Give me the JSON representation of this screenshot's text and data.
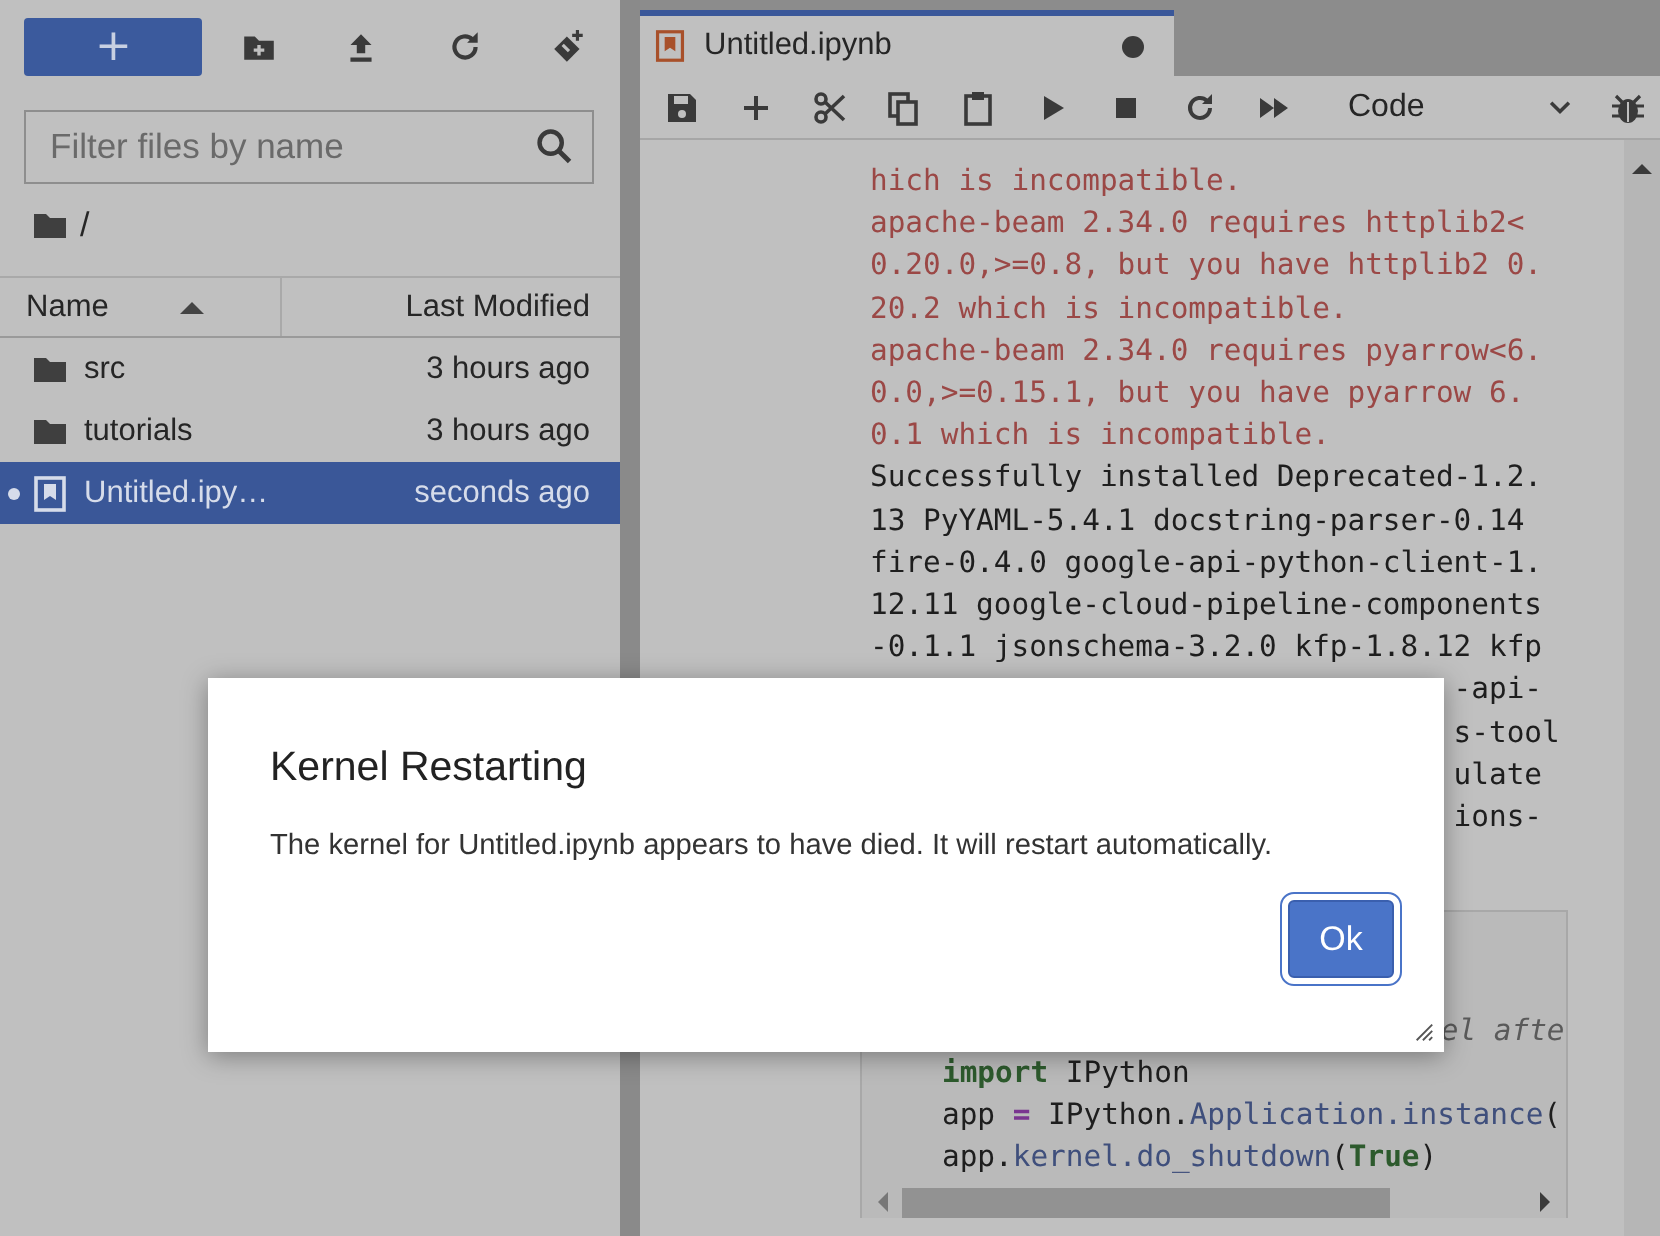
{
  "sidebar": {
    "new_button": "+",
    "filter": {
      "placeholder": "Filter files by name"
    },
    "breadcrumb": "/",
    "columns": [
      {
        "label": "Name",
        "sorted": true
      },
      {
        "label": "Last Modified",
        "sorted": false
      }
    ],
    "files": [
      {
        "kind": "folder",
        "name": "src",
        "modified": "3 hours ago",
        "selected": false,
        "running": false
      },
      {
        "kind": "folder",
        "name": "tutorials",
        "modified": "3 hours ago",
        "selected": false,
        "running": false
      },
      {
        "kind": "notebook",
        "name": "Untitled.ipy…",
        "modified": "seconds ago",
        "selected": true,
        "running": true
      }
    ]
  },
  "notebook": {
    "tab": {
      "title": "Untitled.ipynb",
      "dirty": true
    },
    "cell_type": "Code",
    "output": [
      {
        "kind": "stderr",
        "text": "hich is incompatible."
      },
      {
        "kind": "stderr",
        "text": "apache-beam 2.34.0 requires httplib2<"
      },
      {
        "kind": "stderr",
        "text": "0.20.0,>=0.8, but you have httplib2 0."
      },
      {
        "kind": "stderr",
        "text": "20.2 which is incompatible."
      },
      {
        "kind": "stderr",
        "text": "apache-beam 2.34.0 requires pyarrow<6."
      },
      {
        "kind": "stderr",
        "text": "0.0,>=0.15.1, but you have pyarrow 6."
      },
      {
        "kind": "stderr",
        "text": "0.1 which is incompatible."
      },
      {
        "kind": "stdout",
        "text": "Successfully installed Deprecated-1.2."
      },
      {
        "kind": "stdout",
        "text": "13 PyYAML-5.4.1 docstring-parser-0.14"
      },
      {
        "kind": "stdout",
        "text": "fire-0.4.0 google-api-python-client-1."
      },
      {
        "kind": "stdout",
        "text": "12.11 google-cloud-pipeline-components"
      },
      {
        "kind": "stdout",
        "text": "-0.1.1 jsonschema-3.2.0 kfp-1.8.12 kfp"
      },
      {
        "kind": "covered",
        "text": "-api-"
      },
      {
        "kind": "covered",
        "text": "s-tool"
      },
      {
        "kind": "covered",
        "text": "ulate"
      },
      {
        "kind": "covered",
        "text": "ions-"
      }
    ],
    "code": [
      [
        {
          "kind": "covered-comment",
          "text": "el afte"
        }
      ],
      [
        {
          "kind": "keyword",
          "text": "import"
        },
        {
          "kind": "plain",
          "text": " IPython"
        }
      ],
      [
        {
          "kind": "plain",
          "text": "app "
        },
        {
          "kind": "operator",
          "text": "="
        },
        {
          "kind": "plain",
          "text": " IPython."
        },
        {
          "kind": "attr",
          "text": "Application.instance"
        },
        {
          "kind": "plain",
          "text": "("
        }
      ],
      [
        {
          "kind": "plain",
          "text": "app."
        },
        {
          "kind": "attr",
          "text": "kernel.do_shutdown"
        },
        {
          "kind": "plain",
          "text": "("
        },
        {
          "kind": "keyword",
          "text": "True"
        },
        {
          "kind": "plain",
          "text": ")"
        }
      ]
    ]
  },
  "dialog": {
    "title": "Kernel Restarting",
    "message": "The kernel for Untitled.ipynb appears to have died. It will restart automatically.",
    "button": "Ok",
    "button_focused": true
  }
}
